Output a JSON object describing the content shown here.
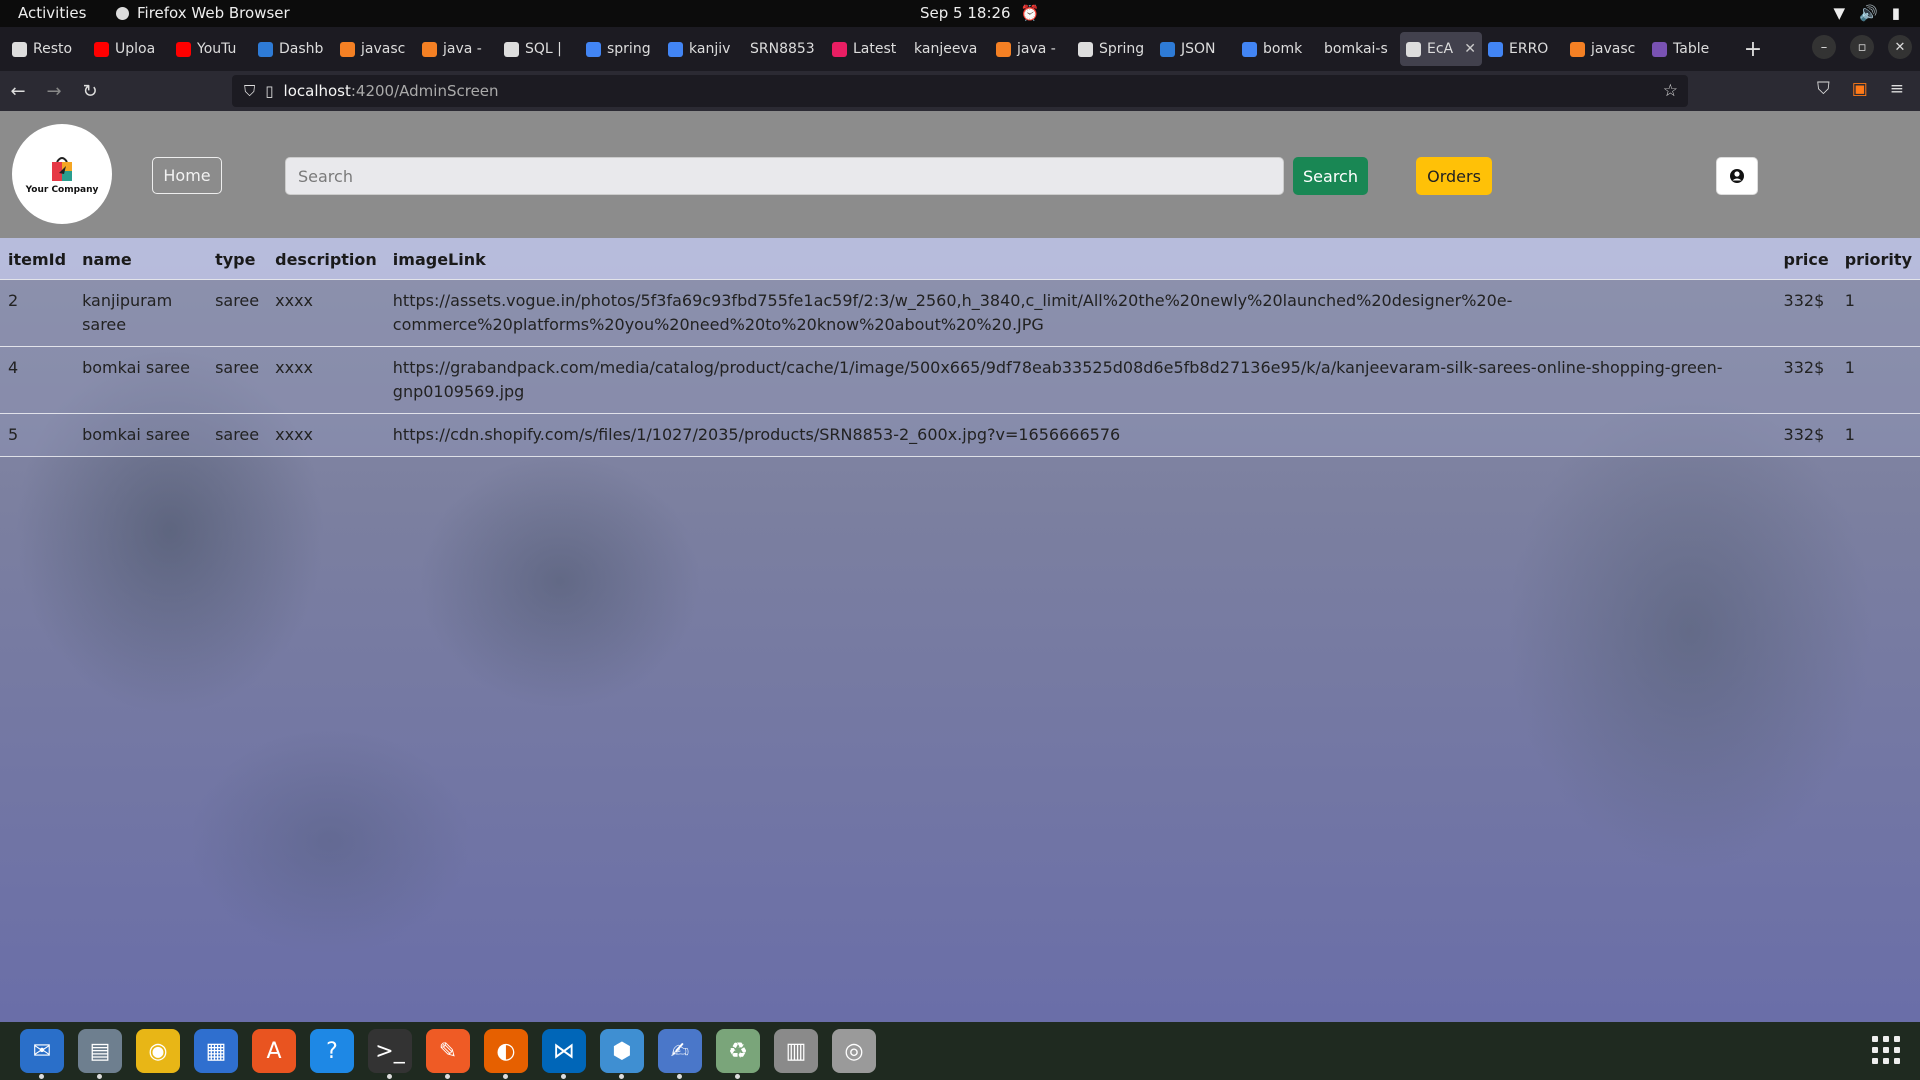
{
  "system_bar": {
    "activities": "Activities",
    "app_name": "Firefox Web Browser",
    "clock": "Sep 5  18:26"
  },
  "tabs": [
    {
      "label": "Resto",
      "color": "#dddddd"
    },
    {
      "label": "Uploa",
      "color": "#ff0000"
    },
    {
      "label": "YouTu",
      "color": "#ff0000"
    },
    {
      "label": "Dashb",
      "color": "#2e7bd6"
    },
    {
      "label": "javasc",
      "color": "#f48024"
    },
    {
      "label": "java -",
      "color": "#f48024"
    },
    {
      "label": "SQL |",
      "color": "#dddddd"
    },
    {
      "label": "spring",
      "color": "#4285f4"
    },
    {
      "label": "kanjiv",
      "color": "#4285f4"
    },
    {
      "label": "SRN8853",
      "color": ""
    },
    {
      "label": "Latest",
      "color": "#e91e63"
    },
    {
      "label": "kanjeeva",
      "color": ""
    },
    {
      "label": "java -",
      "color": "#f48024"
    },
    {
      "label": "Spring",
      "color": "#dddddd"
    },
    {
      "label": "JSON",
      "color": "#2e7bd6"
    },
    {
      "label": "bomk",
      "color": "#4285f4"
    },
    {
      "label": "bomkai-s",
      "color": ""
    },
    {
      "label": "EcA",
      "color": "#dddddd",
      "active": true
    },
    {
      "label": "ERRO",
      "color": "#4285f4"
    },
    {
      "label": "javasc",
      "color": "#f48024"
    },
    {
      "label": "Table",
      "color": "#7952b3"
    }
  ],
  "url": {
    "host": "localhost",
    "path": ":4200/AdminScreen"
  },
  "header": {
    "logo_text": "Your Company",
    "home_label": "Home",
    "search_placeholder": "Search",
    "search_label": "Search",
    "orders_label": "Orders"
  },
  "table": {
    "columns": [
      "itemId",
      "name",
      "type",
      "description",
      "imageLink",
      "price",
      "priority"
    ],
    "rows": [
      {
        "itemId": "2",
        "name": "kanjipuram saree",
        "type": "saree",
        "description": "xxxx",
        "imageLink": "https://assets.vogue.in/photos/5f3fa69c93fbd755fe1ac59f/2:3/w_2560,h_3840,c_limit/All%20the%20newly%20launched%20designer%20e-commerce%20platforms%20you%20need%20to%20know%20about%20%20.JPG",
        "price": "332$",
        "priority": "1"
      },
      {
        "itemId": "4",
        "name": "bomkai saree",
        "type": "saree",
        "description": "xxxx",
        "imageLink": "https://grabandpack.com/media/catalog/product/cache/1/image/500x665/9df78eab33525d08d6e5fb8d27136e95/k/a/kanjeevaram-silk-sarees-online-shopping-green-gnp0109569.jpg",
        "price": "332$",
        "priority": "1"
      },
      {
        "itemId": "5",
        "name": "bomkai saree",
        "type": "saree",
        "description": "xxxx",
        "imageLink": "https://cdn.shopify.com/s/files/1/1027/2035/products/SRN8853-2_600x.jpg?v=1656666576",
        "price": "332$",
        "priority": "1"
      }
    ]
  },
  "colors": {
    "search_button": "#198754",
    "orders_button": "#ffc107",
    "header_bg": "#8c8c8c"
  },
  "dock": [
    {
      "name": "thunderbird-icon",
      "color": "#2a6fc9",
      "glyph": "✉",
      "running": true
    },
    {
      "name": "files-icon",
      "color": "#6e7f8f",
      "glyph": "▤",
      "running": true
    },
    {
      "name": "rhythmbox-icon",
      "color": "#e8b616",
      "glyph": "◉",
      "running": false
    },
    {
      "name": "writer-icon",
      "color": "#2f6fcf",
      "glyph": "▦",
      "running": false
    },
    {
      "name": "app-center-icon",
      "color": "#e95420",
      "glyph": "A",
      "running": false
    },
    {
      "name": "help-icon",
      "color": "#1e88e5",
      "glyph": "?",
      "running": false
    },
    {
      "name": "terminal-icon",
      "color": "#333333",
      "glyph": ">_",
      "running": true
    },
    {
      "name": "postman-icon",
      "color": "#ef5b25",
      "glyph": "✎",
      "running": true
    },
    {
      "name": "firefox-icon",
      "color": "#e66000",
      "glyph": "◐",
      "running": true
    },
    {
      "name": "vscode-icon",
      "color": "#0066b8",
      "glyph": "⋈",
      "running": true
    },
    {
      "name": "virtualbox-icon",
      "color": "#3f8fd2",
      "glyph": "⬢",
      "running": true
    },
    {
      "name": "text-editor-icon",
      "color": "#4a77c9",
      "glyph": "✍",
      "running": true
    },
    {
      "name": "trash-icon",
      "color": "#7aa57a",
      "glyph": "♻",
      "running": true
    },
    {
      "name": "archive-icon",
      "color": "#8a8a8a",
      "glyph": "▥",
      "running": false
    },
    {
      "name": "disk-icon",
      "color": "#9a9a9a",
      "glyph": "◎",
      "running": false
    }
  ]
}
